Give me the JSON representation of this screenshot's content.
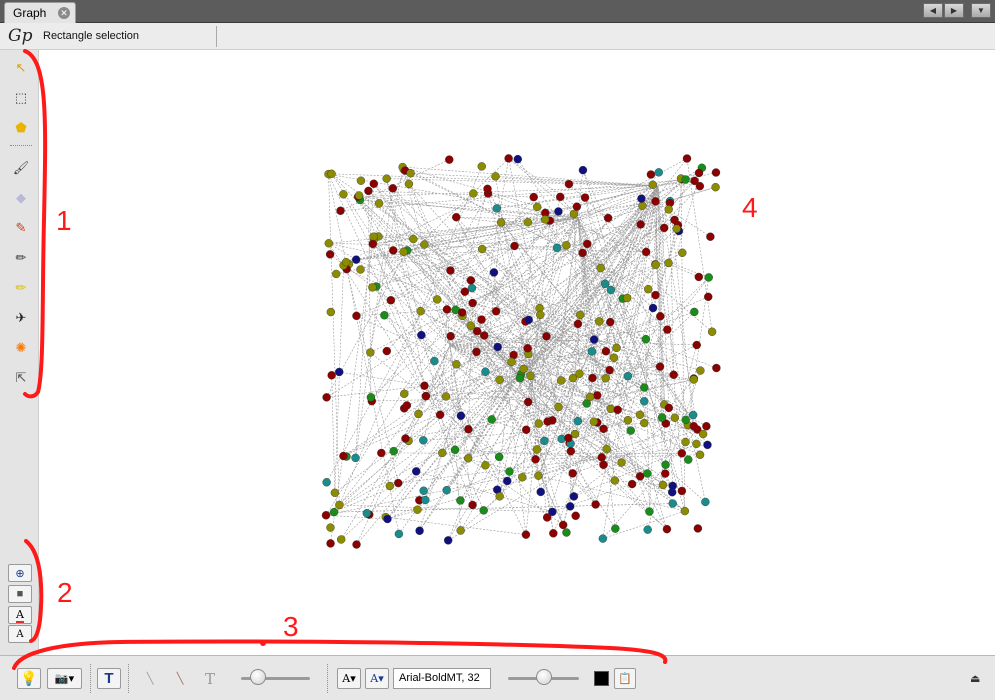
{
  "window": {
    "tab_title": "Graph",
    "tab_close_icon": "close-icon",
    "nav_buttons": [
      "◀",
      "▶",
      "▼"
    ]
  },
  "selection_toolbar": {
    "logo_text": "Gp",
    "mode_label": "Rectangle selection"
  },
  "left_tools": [
    {
      "icon": "arrow-pointer-icon",
      "glyph": "↖",
      "color": "#e0a000"
    },
    {
      "icon": "rectangle-selection-icon",
      "glyph": "⬚",
      "color": "#333333"
    },
    {
      "icon": "lasso-selection-icon",
      "glyph": "⬟",
      "color": "#e8b400"
    },
    {
      "icon": "paint-brush-icon",
      "glyph": "🖌",
      "color": "#444444"
    },
    {
      "icon": "diamond-icon",
      "glyph": "◆",
      "color": "#b8b8d8"
    },
    {
      "icon": "painter-icon",
      "glyph": "✎",
      "color": "#d04020"
    },
    {
      "icon": "pencil-icon",
      "glyph": "✏",
      "color": "#333333"
    },
    {
      "icon": "highlighter-icon",
      "glyph": "✏",
      "color": "#d8c000"
    },
    {
      "icon": "airplane-icon",
      "glyph": "✈",
      "color": "#222222"
    },
    {
      "icon": "gear-icon",
      "glyph": "✺",
      "color": "#ff7a00"
    },
    {
      "icon": "help-pointer-icon",
      "glyph": "⇱",
      "color": "#555555"
    }
  ],
  "side_buttons": [
    {
      "icon": "zoom-icon",
      "glyph": "⊕"
    },
    {
      "icon": "background-color-icon",
      "glyph": "■"
    },
    {
      "icon": "font-color-icon",
      "glyph": "A"
    },
    {
      "icon": "font-icon",
      "glyph": "A"
    }
  ],
  "bottom_toolbar": {
    "font_label": "Arial-BoldMT, 32",
    "font_size_down": "A",
    "font_size_up": "A",
    "text_tool": "T",
    "slider1_value": 0.25,
    "slider2_value": 0.5,
    "color_swatch": "#000000"
  },
  "annotations": {
    "label_1": "1",
    "label_2": "2",
    "label_3": "3",
    "label_4": "4",
    "color": "#ff1a1a"
  },
  "graph_colors": {
    "red": "#8b0000",
    "olive": "#8c8c00",
    "green": "#1a8c1a",
    "teal": "#1a8c8c",
    "navy": "#101080",
    "edge": "#9a9a9a"
  }
}
